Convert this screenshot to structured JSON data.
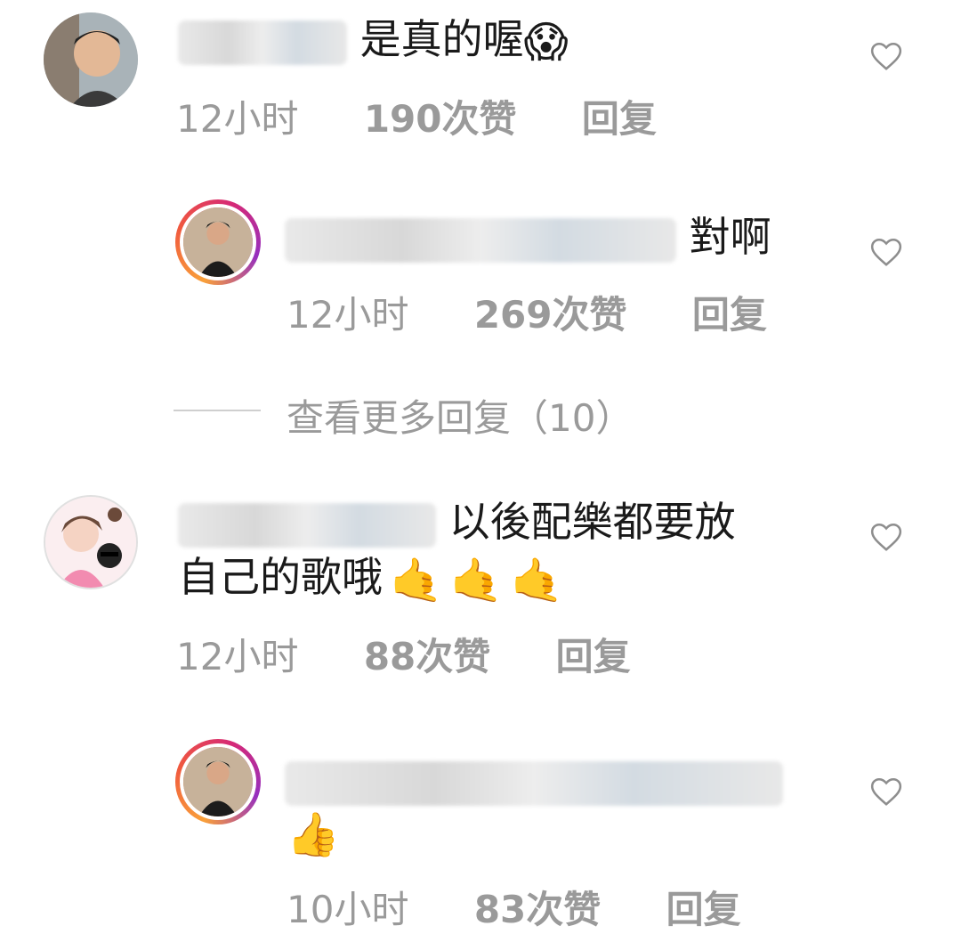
{
  "comments": [
    {
      "text": "是真的喔",
      "emoji": "😱",
      "time": "12小时",
      "likes": "190次赞",
      "reply": "回复"
    },
    {
      "text": "對啊",
      "time": "12小时",
      "likes": "269次赞",
      "reply": "回复"
    },
    {
      "text_line1": "以後配樂都要放",
      "text_line2": "自己的歌哦",
      "emoji": "🤙🤙🤙",
      "time": "12小时",
      "likes": "88次赞",
      "reply": "回复"
    },
    {
      "emoji": "👍",
      "time": "10小时",
      "likes": "83次赞",
      "reply": "回复"
    }
  ],
  "more_replies": "查看更多回复（10）",
  "colors": {
    "meta": "#9a9a9a",
    "text": "#1a1a1a",
    "ring": "#d62976"
  }
}
